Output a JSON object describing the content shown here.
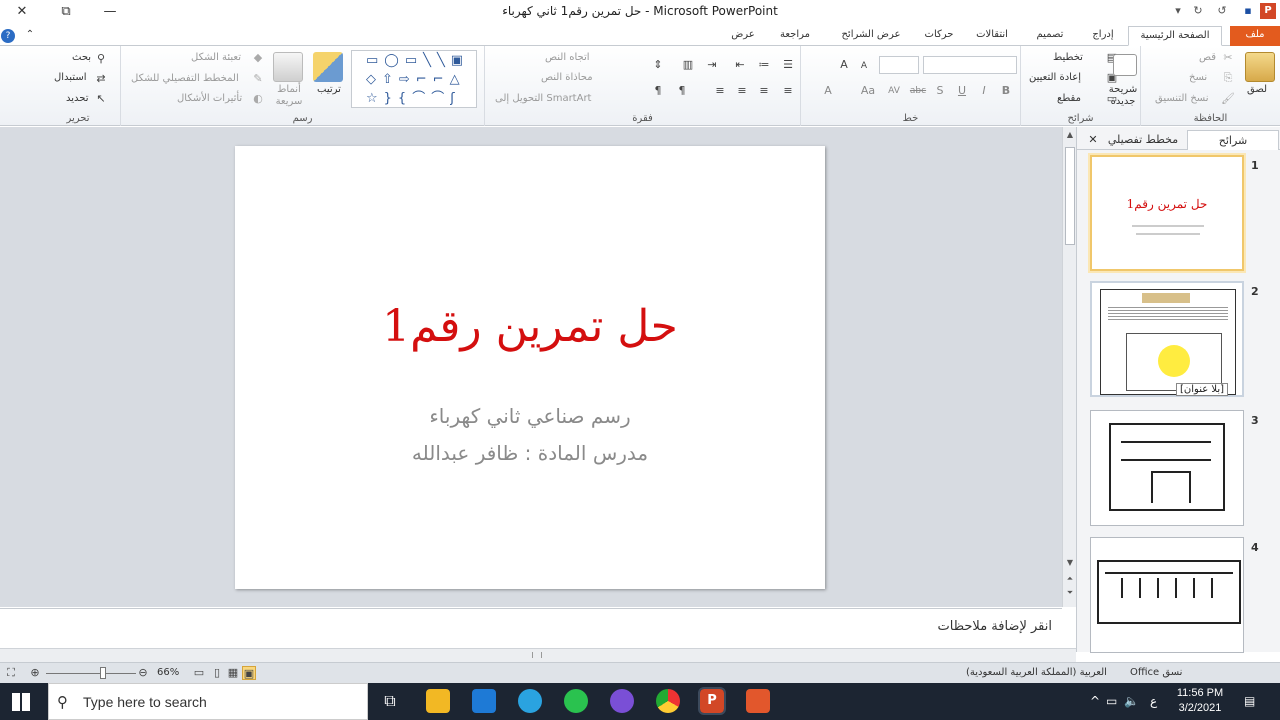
{
  "window": {
    "title": "حل تمرين رقم1 ثاني كهرباء - Microsoft PowerPoint",
    "close_glyph": "✕",
    "restore_glyph": "⧉",
    "minimize_glyph": "—"
  },
  "tabs": {
    "file": "ملف",
    "home": "الصفحة الرئيسية",
    "insert": "إدراج",
    "design": "تصميم",
    "transitions": "انتقالات",
    "animations": "حركات",
    "slideshow": "عرض الشرائح",
    "review": "مراجعة",
    "view": "عرض"
  },
  "ribbon": {
    "clipboard": {
      "label": "الحافظة",
      "paste": "لصق",
      "cut": "قص",
      "copy": "نسخ",
      "format_painter": "نسخ التنسيق"
    },
    "slides": {
      "label": "شرائح",
      "new_slide": "شريحة جديدة",
      "layout": "تخطيط",
      "reset": "إعادة التعيين",
      "section": "مقطع"
    },
    "font": {
      "label": "خط",
      "bold": "B",
      "italic": "I",
      "underline": "U",
      "shadow": "S",
      "strike": "abc",
      "spacing": "AV",
      "case": "Aa",
      "color": "A",
      "grow": "A",
      "shrink": "A"
    },
    "paragraph": {
      "label": "فقرة",
      "text_direction": "اتجاه النص",
      "align_text": "محاذاة النص",
      "smartart": "التحويل إلى SmartArt"
    },
    "drawing": {
      "label": "رسم",
      "arrange": "ترتيب",
      "quick_styles": "أنماط سريعة",
      "shape_fill": "تعبئة الشكل",
      "shape_outline": "المخطط التفصيلي للشكل",
      "shape_effects": "تأثيرات الأشكال"
    },
    "editing": {
      "label": "تحرير",
      "find": "بحث",
      "replace": "استبدال",
      "select": "تحديد"
    }
  },
  "pane": {
    "tab_slides": "شرائح",
    "tab_outline": "مخطط تفصيلي",
    "close": "✕",
    "thumbs": [
      {
        "num": "1",
        "title": "حل تمرين رقم1"
      },
      {
        "num": "2",
        "tooltip": "[بلا عنوان]"
      },
      {
        "num": "3"
      },
      {
        "num": "4"
      }
    ]
  },
  "slide": {
    "title": "حل تمرين رقم1",
    "subtitle1": "رسم صناعي ثاني كهرباء",
    "subtitle2": "مدرس المادة : ظافر عبدالله"
  },
  "notes": {
    "placeholder": "انقر لإضافة ملاحظات"
  },
  "status": {
    "zoom": "66%",
    "language": "العربية (المملكة العربية السعودية)",
    "theme": "نسق Office"
  },
  "taskbar": {
    "search_placeholder": "Type here to search",
    "time": "11:56 PM",
    "date": "3/2/2021",
    "lang": "ع"
  },
  "colors": {
    "accent": "#e35b1e",
    "slide_title": "#d40f0f",
    "subtitle": "#8a8a8a",
    "taskbar": "#1c2532"
  }
}
